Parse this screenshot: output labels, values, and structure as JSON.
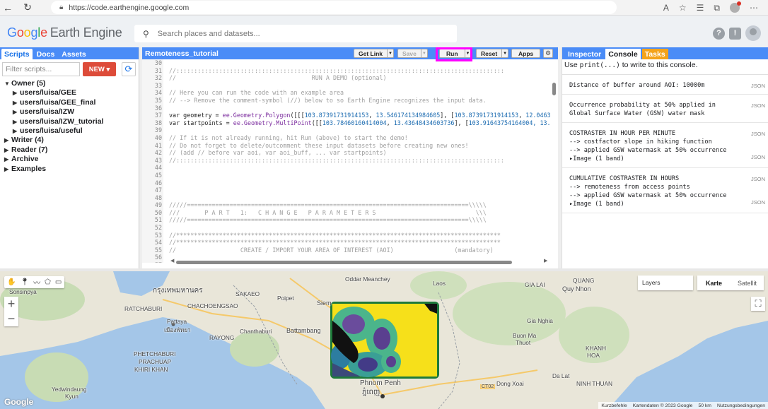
{
  "browser": {
    "url": "https://code.earthengine.google.com"
  },
  "header": {
    "logo_google": "Google",
    "logo_rest": "Earth Engine",
    "search_placeholder": "Search places and datasets..."
  },
  "left_panel": {
    "tabs": [
      "Scripts",
      "Docs",
      "Assets"
    ],
    "filter_placeholder": "Filter scripts...",
    "new_label": "NEW",
    "tree": {
      "owner": "Owner (5)",
      "owner_items": [
        "users/luisa/GEE",
        "users/luisa/GEE_final",
        "users/luisa/IZW",
        "users/luisa/IZW_tutorial",
        "users/luisa/useful"
      ],
      "writer": "Writer (4)",
      "reader": "Reader (7)",
      "archive": "Archive",
      "examples": "Examples"
    }
  },
  "editor": {
    "title": "Remoteness_tutorial",
    "buttons": {
      "get_link": "Get Link",
      "save": "Save",
      "run": "Run",
      "reset": "Reset",
      "apps": "Apps"
    },
    "lines": [
      {
        "n": "30",
        "parts": [
          {
            "t": "",
            "c": "c-def"
          }
        ]
      },
      {
        "n": "31",
        "parts": [
          {
            "t": "//::::::::::::::::::::::::::::::::::::::::::::::::::::::::::::::::::::::::::::::::::::::::::::",
            "c": "c-com"
          }
        ]
      },
      {
        "n": "32",
        "parts": [
          {
            "t": "//                                      RUN A DEMO (optional)",
            "c": "c-com"
          }
        ]
      },
      {
        "n": "33",
        "parts": [
          {
            "t": "",
            "c": "c-def"
          }
        ]
      },
      {
        "n": "34",
        "parts": [
          {
            "t": "// Here you can run the code with an example area",
            "c": "c-com"
          }
        ]
      },
      {
        "n": "35",
        "parts": [
          {
            "t": "// --> Remove the comment-symbol (//) below to so Earth Engine recognizes the input data.",
            "c": "c-com"
          }
        ]
      },
      {
        "n": "36",
        "parts": [
          {
            "t": "",
            "c": "c-def"
          }
        ]
      },
      {
        "n": "37",
        "parts": [
          {
            "t": "var ",
            "c": "c-def"
          },
          {
            "t": "geometry",
            "c": "c-def"
          },
          {
            "t": " = ",
            "c": "c-def"
          },
          {
            "t": "ee.Geometry.Polygon",
            "c": "c-kw"
          },
          {
            "t": "([[[",
            "c": "c-def"
          },
          {
            "t": "103.87391731914153",
            "c": "c-num"
          },
          {
            "t": ", ",
            "c": "c-def"
          },
          {
            "t": "13.546174134984605",
            "c": "c-num"
          },
          {
            "t": "], [",
            "c": "c-def"
          },
          {
            "t": "103.87391731914153",
            "c": "c-num"
          },
          {
            "t": ", ",
            "c": "c-def"
          },
          {
            "t": "12.0463",
            "c": "c-num"
          }
        ]
      },
      {
        "n": "38",
        "parts": [
          {
            "t": "var ",
            "c": "c-def"
          },
          {
            "t": "startpoints",
            "c": "c-def"
          },
          {
            "t": " = ",
            "c": "c-def"
          },
          {
            "t": "ee.Geometry.MultiPoint",
            "c": "c-kw"
          },
          {
            "t": "([[",
            "c": "c-def"
          },
          {
            "t": "103.78460160414004",
            "c": "c-num"
          },
          {
            "t": ", ",
            "c": "c-def"
          },
          {
            "t": "13.43648434603736",
            "c": "c-num"
          },
          {
            "t": "], [",
            "c": "c-def"
          },
          {
            "t": "103.91643754164004",
            "c": "c-num"
          },
          {
            "t": ", 13.",
            "c": "c-num"
          }
        ]
      },
      {
        "n": "39",
        "parts": [
          {
            "t": "",
            "c": "c-def"
          }
        ]
      },
      {
        "n": "40",
        "parts": [
          {
            "t": "// If it is not already running, hit Run (above) to start the demo!",
            "c": "c-com"
          }
        ]
      },
      {
        "n": "41",
        "parts": [
          {
            "t": "// Do not forget to delete/outcomment these input datasets before creating new ones!",
            "c": "c-com"
          }
        ]
      },
      {
        "n": "42",
        "parts": [
          {
            "t": "// (add // before var aoi, var aoi_buff, ... var startpoints)",
            "c": "c-com"
          }
        ]
      },
      {
        "n": "43",
        "parts": [
          {
            "t": "//::::::::::::::::::::::::::::::::::::::::::::::::::::::::::::::::::::::::::::::::::::::::::::",
            "c": "c-com"
          }
        ]
      },
      {
        "n": "44",
        "parts": [
          {
            "t": "",
            "c": "c-def"
          }
        ]
      },
      {
        "n": "45",
        "parts": [
          {
            "t": "",
            "c": "c-def"
          }
        ]
      },
      {
        "n": "46",
        "parts": [
          {
            "t": "",
            "c": "c-def"
          }
        ]
      },
      {
        "n": "47",
        "parts": [
          {
            "t": "",
            "c": "c-def"
          }
        ]
      },
      {
        "n": "48",
        "parts": [
          {
            "t": "",
            "c": "c-def"
          }
        ]
      },
      {
        "n": "49",
        "parts": [
          {
            "t": "/////===============================================================================\\\\\\\\\\",
            "c": "c-com"
          }
        ]
      },
      {
        "n": "50",
        "parts": [
          {
            "t": "///       P A R T   1:   C H A N G E   P A R A M E T E R S                            \\\\\\",
            "c": "c-com"
          }
        ]
      },
      {
        "n": "51",
        "parts": [
          {
            "t": "/////===============================================================================\\\\\\\\\\",
            "c": "c-com"
          }
        ]
      },
      {
        "n": "52",
        "parts": [
          {
            "t": "",
            "c": "c-def"
          }
        ]
      },
      {
        "n": "53",
        "parts": [
          {
            "t": "//*******************************************************************************************",
            "c": "c-com"
          }
        ]
      },
      {
        "n": "54",
        "parts": [
          {
            "t": "//*******************************************************************************************",
            "c": "c-com"
          }
        ]
      },
      {
        "n": "55",
        "parts": [
          {
            "t": "//                  CREATE / IMPORT YOUR AREA OF INTEREST (AOI)                 (mandatory)",
            "c": "c-com"
          }
        ]
      },
      {
        "n": "56",
        "parts": [
          {
            "t": "",
            "c": "c-def"
          }
        ]
      },
      {
        "n": "57",
        "parts": [
          {
            "t": "",
            "c": "c-def"
          }
        ]
      }
    ]
  },
  "right_panel": {
    "tabs": [
      "Inspector",
      "Console",
      "Tasks"
    ],
    "hint_pre": "Use ",
    "hint_code": "print(...)",
    "hint_post": " to write to this console.",
    "json_label": "JSON",
    "entries": [
      {
        "lines": [
          "Distance of buffer around AOI: 10000m"
        ],
        "image": ""
      },
      {
        "lines": [
          "Occurrence probability at 50% applied in",
          " Global Surface Water (GSW) water mask"
        ],
        "image": ""
      },
      {
        "lines": [
          "COSTRASTER IN HOUR PER MINUTE",
          "--> costfactor slope in hiking function",
          "--> applied GSW watermask at 50% occurrence"
        ],
        "image": "Image (1 band)"
      },
      {
        "lines": [
          "CUMULATIVE COSTRASTER IN HOURS",
          "--> remoteness from access points",
          "--> applied GSW watermask at 50% occurrence"
        ],
        "image": "Image (1 band)"
      }
    ]
  },
  "map": {
    "layers_label": "Layers",
    "maptype": [
      "Karte",
      "Satellit"
    ],
    "google_logo": "Google",
    "attribution": [
      "Kurzbefehle",
      "Kartendaten © 2023 Google",
      "50 km",
      "Nutzungsbedingungen"
    ],
    "places": [
      {
        "name": "Sonsinpya"
      },
      {
        "name": "กรุงเทพมหานคร"
      },
      {
        "name": "CHACHOENGSAO"
      },
      {
        "name": "RATCHABURI"
      },
      {
        "name": "Pattaya"
      },
      {
        "name": "เมืองพัทยา"
      },
      {
        "name": "RAYONG"
      },
      {
        "name": "Chanthaburi"
      },
      {
        "name": "PHETCHABURI"
      },
      {
        "name": "PRACHUAP"
      },
      {
        "name": "KHIRI KHAN"
      },
      {
        "name": "Yedwindaung"
      },
      {
        "name": "Kyun"
      },
      {
        "name": "SAKAEO"
      },
      {
        "name": "Poipet"
      },
      {
        "name": "Battambang"
      },
      {
        "name": "Siem"
      },
      {
        "name": "Oddar Meanchey"
      },
      {
        "name": "Phnom Penh"
      },
      {
        "name": "ភ្នំពេញ"
      },
      {
        "name": "Gia Nghia"
      },
      {
        "name": "Buon Ma"
      },
      {
        "name": "Thuot"
      },
      {
        "name": "Da Lat"
      },
      {
        "name": "Dong Xoai"
      },
      {
        "name": "KHANH"
      },
      {
        "name": "HOA"
      },
      {
        "name": "NINH THUAN"
      },
      {
        "name": "QUANG"
      },
      {
        "name": "Quy Nhon"
      },
      {
        "name": "GIA LAI"
      },
      {
        "name": "Laos"
      },
      {
        "name": "CT02"
      }
    ]
  }
}
